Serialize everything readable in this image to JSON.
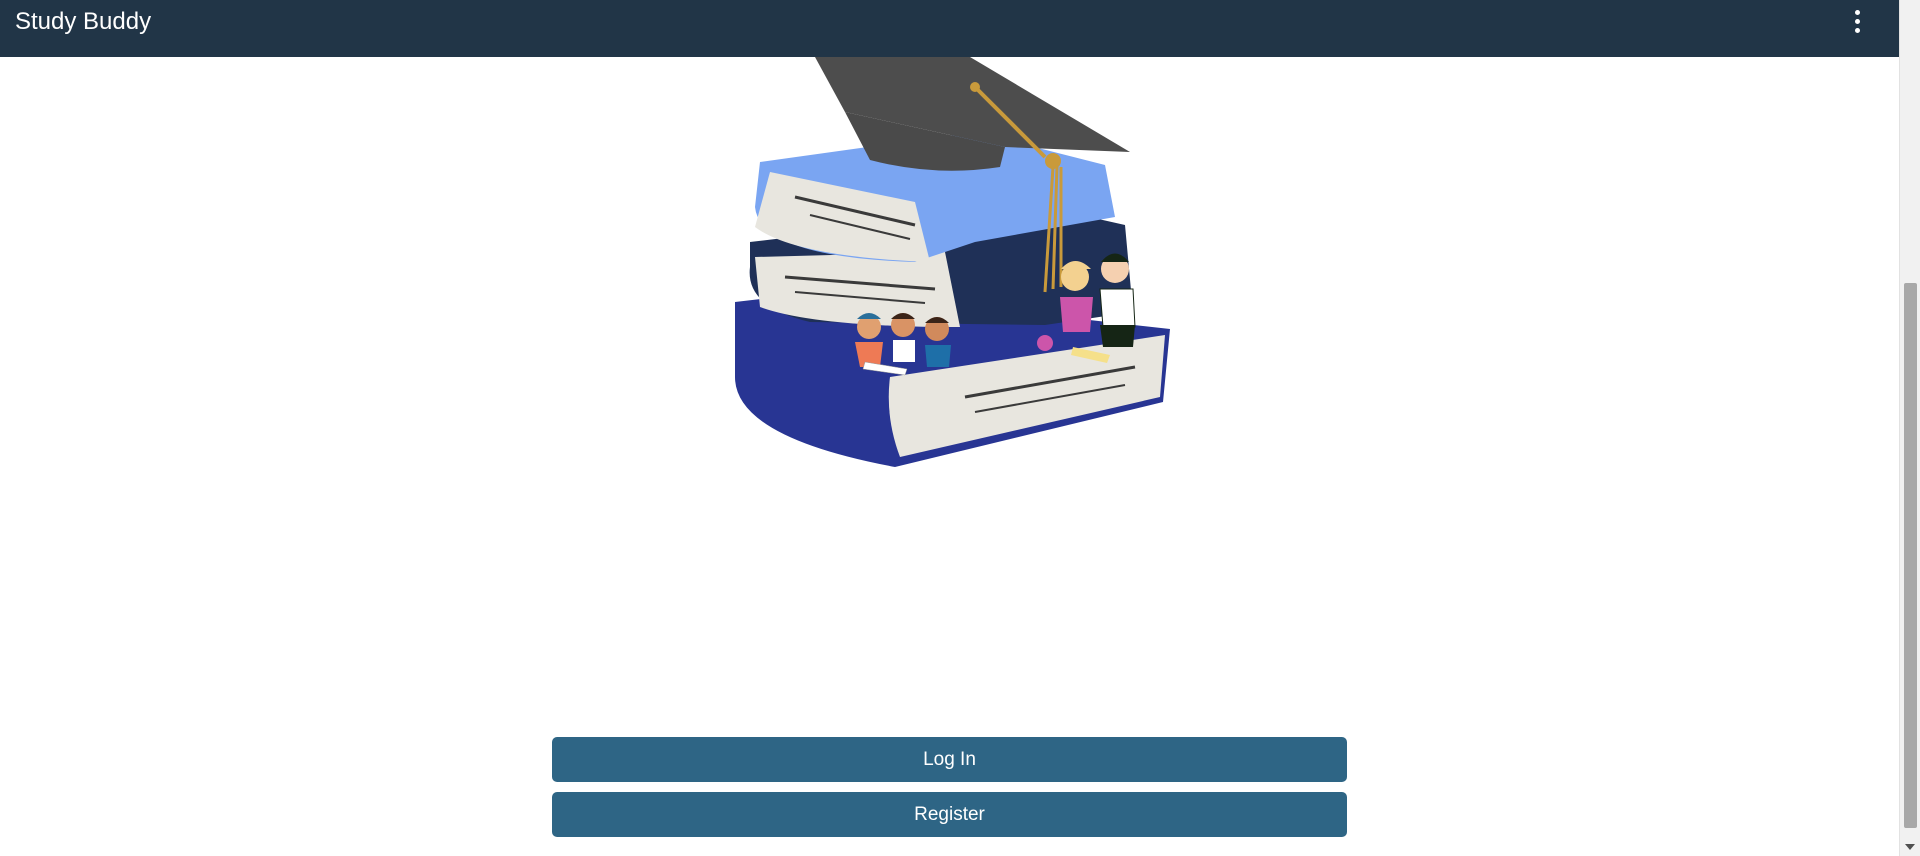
{
  "header": {
    "title": "Study Buddy",
    "menu_icon": "more-vertical-icon"
  },
  "hero": {
    "illustration": "books-graduation-cap-children-illustration"
  },
  "actions": {
    "login_label": "Log In",
    "register_label": "Register"
  },
  "colors": {
    "header_bg": "#213547",
    "button_bg": "#2e6585",
    "button_text": "#ffffff",
    "page_bg": "#ffffff"
  }
}
